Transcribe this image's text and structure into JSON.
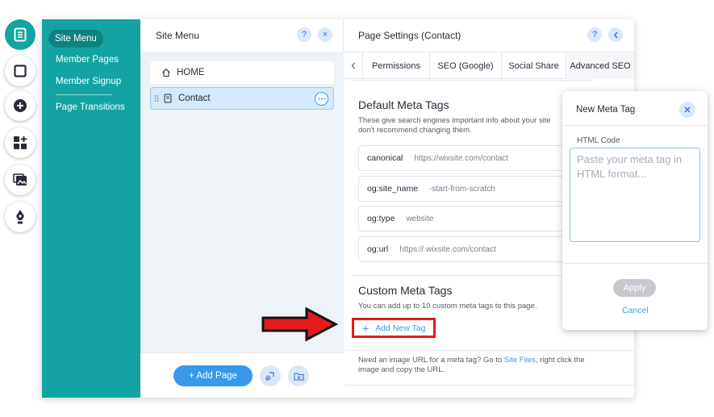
{
  "left_rail": {
    "icons": [
      "pages-icon",
      "background-icon",
      "add-icon",
      "add-apps-icon",
      "media-icon",
      "design-pen-icon"
    ]
  },
  "site_nav": {
    "items": [
      "Site Menu",
      "Member Pages",
      "Member Signup",
      "Page Transitions"
    ]
  },
  "site_menu": {
    "title": "Site Menu",
    "help": "?",
    "close": "×",
    "pages": [
      "HOME",
      "Contact"
    ],
    "add_page_label": "+ Add Page"
  },
  "page_settings": {
    "title": "Page Settings (Contact)",
    "help": "?",
    "tabs": [
      "Permissions",
      "SEO (Google)",
      "Social Share",
      "Advanced SEO"
    ],
    "default_meta": {
      "title": "Default Meta Tags",
      "description_line1": "These give search engines important info about your site",
      "description_line2": "don't recommend changing them.",
      "rows": [
        {
          "key": "canonical",
          "value": "https://wixsite.com/contact"
        },
        {
          "key": "og:site_name",
          "value": "-start-from-scratch"
        },
        {
          "key": "og:type",
          "value": "website"
        },
        {
          "key": "og:url",
          "value": "https:// wixsite.com/contact"
        }
      ]
    },
    "custom_meta": {
      "title": "Custom Meta Tags",
      "description": "You can add up to 10 custom meta tags to this page.",
      "add_label": "Add New Tag"
    },
    "image_note_pre": "Need an image URL for a meta tag? Go to",
    "image_note_link": "Site Files",
    "image_note_post": ", right click the",
    "image_note_line2": "image and copy the URL."
  },
  "popup": {
    "title": "New Meta Tag",
    "field_label": "HTML Code",
    "placeholder": "Paste your meta tag in HTML format...",
    "apply_label": "Apply",
    "cancel_label": "Cancel"
  },
  "colors": {
    "teal": "#13a3a2",
    "accent_blue": "#3899ec",
    "annotation_red": "#e51b1b"
  }
}
